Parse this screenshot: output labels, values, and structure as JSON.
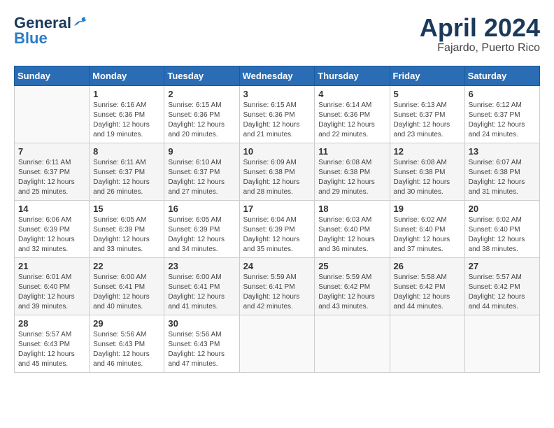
{
  "header": {
    "logo_line1": "General",
    "logo_line2": "Blue",
    "month_year": "April 2024",
    "location": "Fajardo, Puerto Rico"
  },
  "days_of_week": [
    "Sunday",
    "Monday",
    "Tuesday",
    "Wednesday",
    "Thursday",
    "Friday",
    "Saturday"
  ],
  "weeks": [
    [
      {
        "day": "",
        "info": ""
      },
      {
        "day": "1",
        "info": "Sunrise: 6:16 AM\nSunset: 6:36 PM\nDaylight: 12 hours\nand 19 minutes."
      },
      {
        "day": "2",
        "info": "Sunrise: 6:15 AM\nSunset: 6:36 PM\nDaylight: 12 hours\nand 20 minutes."
      },
      {
        "day": "3",
        "info": "Sunrise: 6:15 AM\nSunset: 6:36 PM\nDaylight: 12 hours\nand 21 minutes."
      },
      {
        "day": "4",
        "info": "Sunrise: 6:14 AM\nSunset: 6:36 PM\nDaylight: 12 hours\nand 22 minutes."
      },
      {
        "day": "5",
        "info": "Sunrise: 6:13 AM\nSunset: 6:37 PM\nDaylight: 12 hours\nand 23 minutes."
      },
      {
        "day": "6",
        "info": "Sunrise: 6:12 AM\nSunset: 6:37 PM\nDaylight: 12 hours\nand 24 minutes."
      }
    ],
    [
      {
        "day": "7",
        "info": "Sunrise: 6:11 AM\nSunset: 6:37 PM\nDaylight: 12 hours\nand 25 minutes."
      },
      {
        "day": "8",
        "info": "Sunrise: 6:11 AM\nSunset: 6:37 PM\nDaylight: 12 hours\nand 26 minutes."
      },
      {
        "day": "9",
        "info": "Sunrise: 6:10 AM\nSunset: 6:37 PM\nDaylight: 12 hours\nand 27 minutes."
      },
      {
        "day": "10",
        "info": "Sunrise: 6:09 AM\nSunset: 6:38 PM\nDaylight: 12 hours\nand 28 minutes."
      },
      {
        "day": "11",
        "info": "Sunrise: 6:08 AM\nSunset: 6:38 PM\nDaylight: 12 hours\nand 29 minutes."
      },
      {
        "day": "12",
        "info": "Sunrise: 6:08 AM\nSunset: 6:38 PM\nDaylight: 12 hours\nand 30 minutes."
      },
      {
        "day": "13",
        "info": "Sunrise: 6:07 AM\nSunset: 6:38 PM\nDaylight: 12 hours\nand 31 minutes."
      }
    ],
    [
      {
        "day": "14",
        "info": "Sunrise: 6:06 AM\nSunset: 6:39 PM\nDaylight: 12 hours\nand 32 minutes."
      },
      {
        "day": "15",
        "info": "Sunrise: 6:05 AM\nSunset: 6:39 PM\nDaylight: 12 hours\nand 33 minutes."
      },
      {
        "day": "16",
        "info": "Sunrise: 6:05 AM\nSunset: 6:39 PM\nDaylight: 12 hours\nand 34 minutes."
      },
      {
        "day": "17",
        "info": "Sunrise: 6:04 AM\nSunset: 6:39 PM\nDaylight: 12 hours\nand 35 minutes."
      },
      {
        "day": "18",
        "info": "Sunrise: 6:03 AM\nSunset: 6:40 PM\nDaylight: 12 hours\nand 36 minutes."
      },
      {
        "day": "19",
        "info": "Sunrise: 6:02 AM\nSunset: 6:40 PM\nDaylight: 12 hours\nand 37 minutes."
      },
      {
        "day": "20",
        "info": "Sunrise: 6:02 AM\nSunset: 6:40 PM\nDaylight: 12 hours\nand 38 minutes."
      }
    ],
    [
      {
        "day": "21",
        "info": "Sunrise: 6:01 AM\nSunset: 6:40 PM\nDaylight: 12 hours\nand 39 minutes."
      },
      {
        "day": "22",
        "info": "Sunrise: 6:00 AM\nSunset: 6:41 PM\nDaylight: 12 hours\nand 40 minutes."
      },
      {
        "day": "23",
        "info": "Sunrise: 6:00 AM\nSunset: 6:41 PM\nDaylight: 12 hours\nand 41 minutes."
      },
      {
        "day": "24",
        "info": "Sunrise: 5:59 AM\nSunset: 6:41 PM\nDaylight: 12 hours\nand 42 minutes."
      },
      {
        "day": "25",
        "info": "Sunrise: 5:59 AM\nSunset: 6:42 PM\nDaylight: 12 hours\nand 43 minutes."
      },
      {
        "day": "26",
        "info": "Sunrise: 5:58 AM\nSunset: 6:42 PM\nDaylight: 12 hours\nand 44 minutes."
      },
      {
        "day": "27",
        "info": "Sunrise: 5:57 AM\nSunset: 6:42 PM\nDaylight: 12 hours\nand 44 minutes."
      }
    ],
    [
      {
        "day": "28",
        "info": "Sunrise: 5:57 AM\nSunset: 6:43 PM\nDaylight: 12 hours\nand 45 minutes."
      },
      {
        "day": "29",
        "info": "Sunrise: 5:56 AM\nSunset: 6:43 PM\nDaylight: 12 hours\nand 46 minutes."
      },
      {
        "day": "30",
        "info": "Sunrise: 5:56 AM\nSunset: 6:43 PM\nDaylight: 12 hours\nand 47 minutes."
      },
      {
        "day": "",
        "info": ""
      },
      {
        "day": "",
        "info": ""
      },
      {
        "day": "",
        "info": ""
      },
      {
        "day": "",
        "info": ""
      }
    ]
  ]
}
